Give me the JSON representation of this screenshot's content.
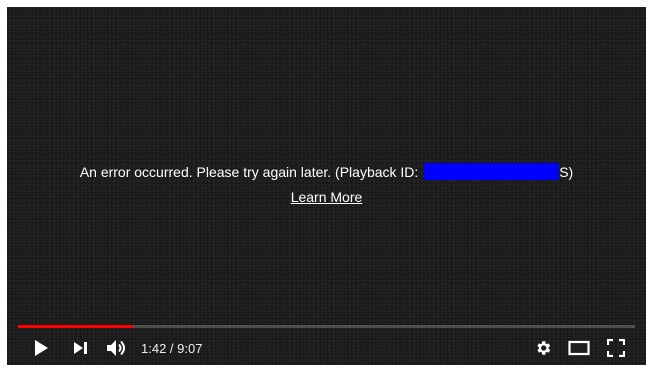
{
  "error": {
    "message_prefix": "An error occurred. Please try again later. (Playback ID: ",
    "message_suffix": "S)",
    "learn_more": "Learn More"
  },
  "player": {
    "progress_fraction": 0.186,
    "time_current": "1:42",
    "time_separator": " / ",
    "time_total": "9:07"
  },
  "icons": {
    "play": "play-icon",
    "next": "next-icon",
    "volume": "volume-icon",
    "settings": "gear-icon",
    "theater": "theater-mode-icon",
    "fullscreen": "fullscreen-icon"
  },
  "colors": {
    "progress": "#ff0000",
    "redaction": "#0000ff",
    "background": "#161616"
  }
}
